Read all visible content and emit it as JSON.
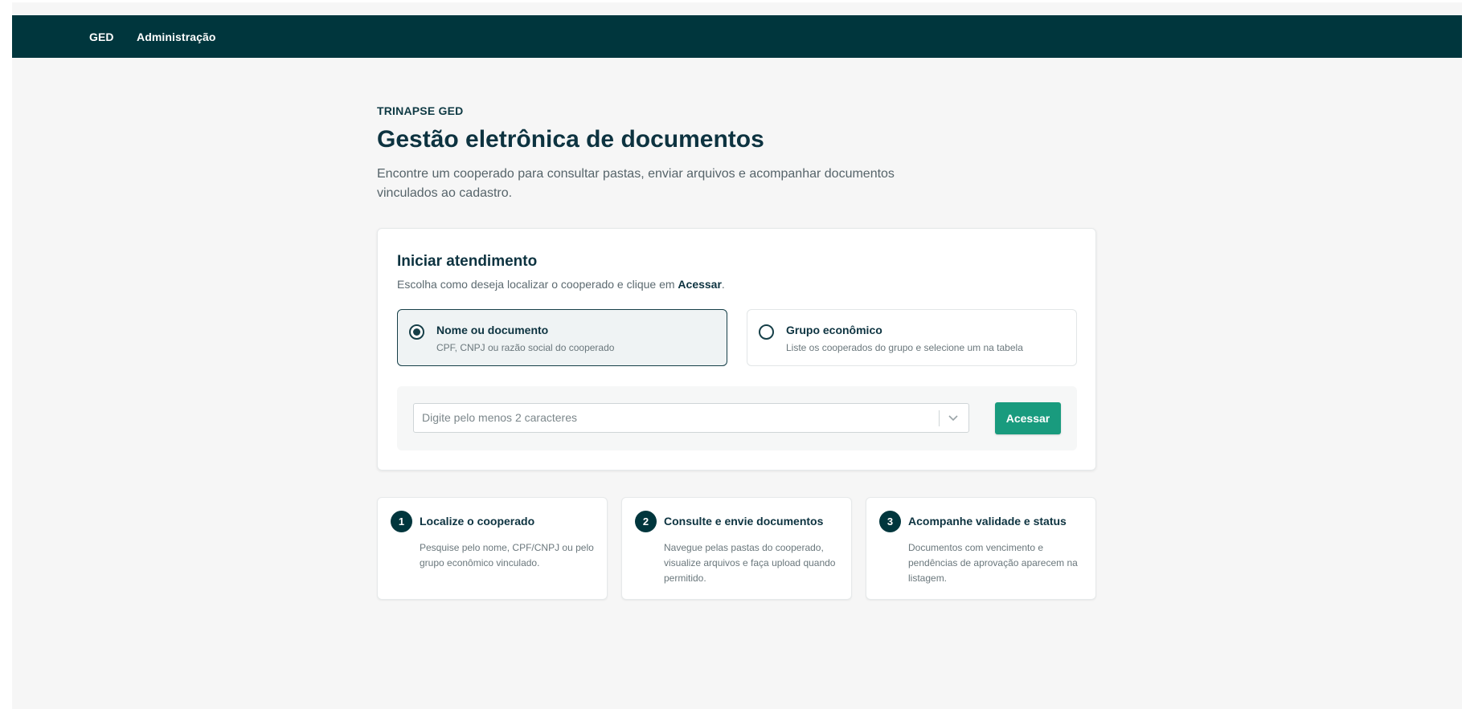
{
  "nav": {
    "brand": "GED",
    "admin": "Administração"
  },
  "hero": {
    "eyebrow": "TRINAPSE GED",
    "title": "Gestão eletrônica de documentos",
    "lead": "Encontre um cooperado para consultar pastas, enviar arquivos e acompanhar documentos vinculados ao cadastro."
  },
  "card": {
    "title": "Iniciar atendimento",
    "subtitle_prefix": "Escolha como deseja localizar o cooperado e clique em ",
    "subtitle_emphasis": "Acessar",
    "subtitle_suffix": ".",
    "options": [
      {
        "label": "Nome ou documento",
        "description": "CPF, CNPJ ou razão social do cooperado",
        "selected": true
      },
      {
        "label": "Grupo econômico",
        "description": "Liste os cooperados do grupo e selecione um na tabela",
        "selected": false
      }
    ],
    "search": {
      "placeholder": "Digite pelo menos 2 caracteres",
      "button": "Acessar"
    }
  },
  "steps": [
    {
      "number": "1",
      "title": "Localize o cooperado",
      "description": "Pesquise pelo nome, CPF/CNPJ ou pelo grupo econômico vinculado."
    },
    {
      "number": "2",
      "title": "Consulte e envie documentos",
      "description": "Navegue pelas pastas do cooperado, visualize arquivos e faça upload quando permitido."
    },
    {
      "number": "3",
      "title": "Acompanhe validade e status",
      "description": "Documentos com vencimento e pendências de aprovação aparecem na listagem."
    }
  ],
  "colors": {
    "topbar": "#00363d",
    "accent_button": "#199b7e",
    "text_dark": "#0d3340"
  }
}
